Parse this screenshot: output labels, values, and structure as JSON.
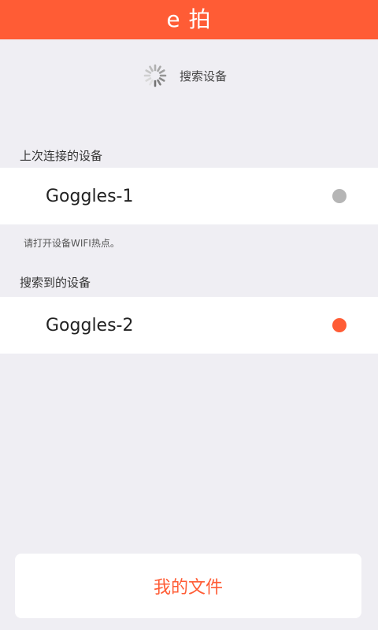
{
  "header": {
    "title": "e 拍",
    "background_color": "#ff5c35"
  },
  "search": {
    "label": "搜索设备",
    "icon": "loading-spinner-icon"
  },
  "last_connected": {
    "section_title": "上次连接的设备",
    "devices": [
      {
        "name": "Goggles-1",
        "status_color": "#b5b5b5"
      }
    ],
    "hint": "请打开设备WIFI热点。"
  },
  "found": {
    "section_title": "搜索到的设备",
    "devices": [
      {
        "name": "Goggles-2",
        "status_color": "#ff5c35"
      }
    ]
  },
  "footer": {
    "files_button_label": "我的文件",
    "accent_color": "#ff5c35"
  }
}
